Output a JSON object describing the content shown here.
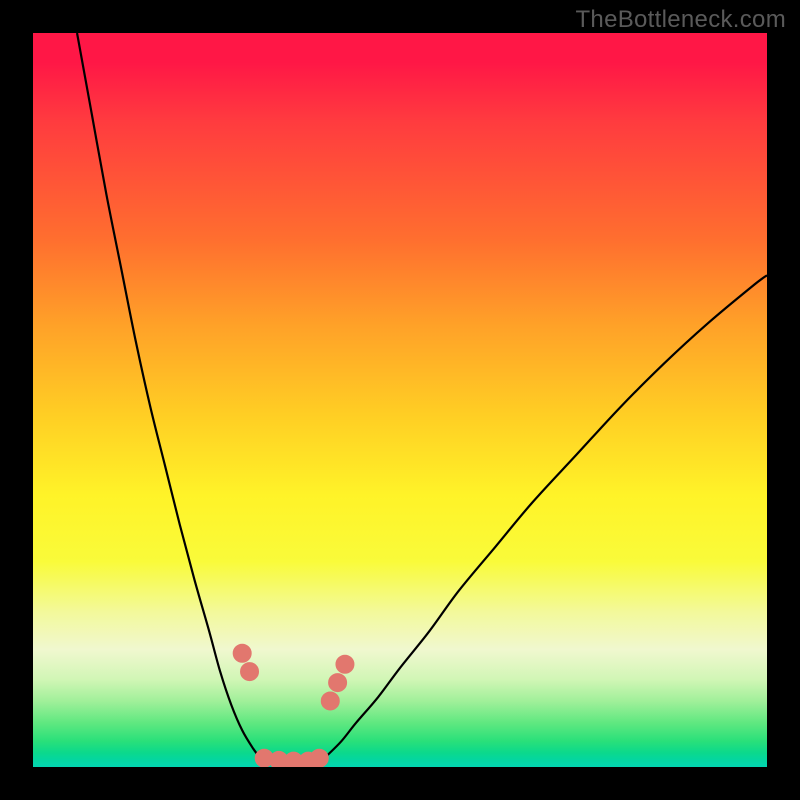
{
  "watermark": {
    "text": "TheBottleneck.com"
  },
  "colors": {
    "frame": "#000000",
    "curve_stroke": "#000000",
    "marker_fill": "#e2776e",
    "marker_stroke": "#e2776e"
  },
  "chart_data": {
    "type": "line",
    "title": "",
    "xlabel": "",
    "ylabel": "",
    "xlim": [
      0,
      100
    ],
    "ylim": [
      0,
      100
    ],
    "grid": false,
    "legend": false,
    "annotations": [],
    "note": "V-shaped bottleneck curve. Values are estimated visual y-heights (percent from bottom of plot area) at estimated x positions (percent across plot area width). No axis ticks or labels are present.",
    "series": [
      {
        "name": "bottleneck-curve-left",
        "x": [
          6,
          8,
          10,
          12,
          14,
          16,
          18,
          20,
          22,
          24,
          25.5,
          27,
          28.5,
          30,
          31
        ],
        "values": [
          100,
          89,
          78,
          68,
          58,
          49,
          41,
          33,
          25.5,
          18.5,
          13,
          8.5,
          5,
          2.5,
          1.2
        ]
      },
      {
        "name": "bottleneck-curve-right",
        "x": [
          40,
          42,
          44,
          47,
          50,
          54,
          58,
          63,
          68,
          74,
          80,
          86,
          92,
          98,
          100
        ],
        "values": [
          1.5,
          3.5,
          6,
          9.5,
          13.5,
          18.5,
          24,
          30,
          36,
          42.5,
          49,
          55,
          60.5,
          65.5,
          67
        ]
      },
      {
        "name": "valley-floor",
        "x": [
          31,
          33,
          35,
          37,
          39,
          40
        ],
        "values": [
          1.2,
          0.9,
          0.8,
          0.8,
          1.0,
          1.5
        ]
      }
    ],
    "markers": {
      "name": "highlighted-points",
      "x": [
        28.5,
        29.5,
        31.5,
        33.5,
        35.5,
        37.5,
        39,
        40.5,
        41.5,
        42.5
      ],
      "values": [
        15.5,
        13,
        1.2,
        0.9,
        0.8,
        0.8,
        1.2,
        9,
        11.5,
        14
      ],
      "radius": 9
    }
  }
}
